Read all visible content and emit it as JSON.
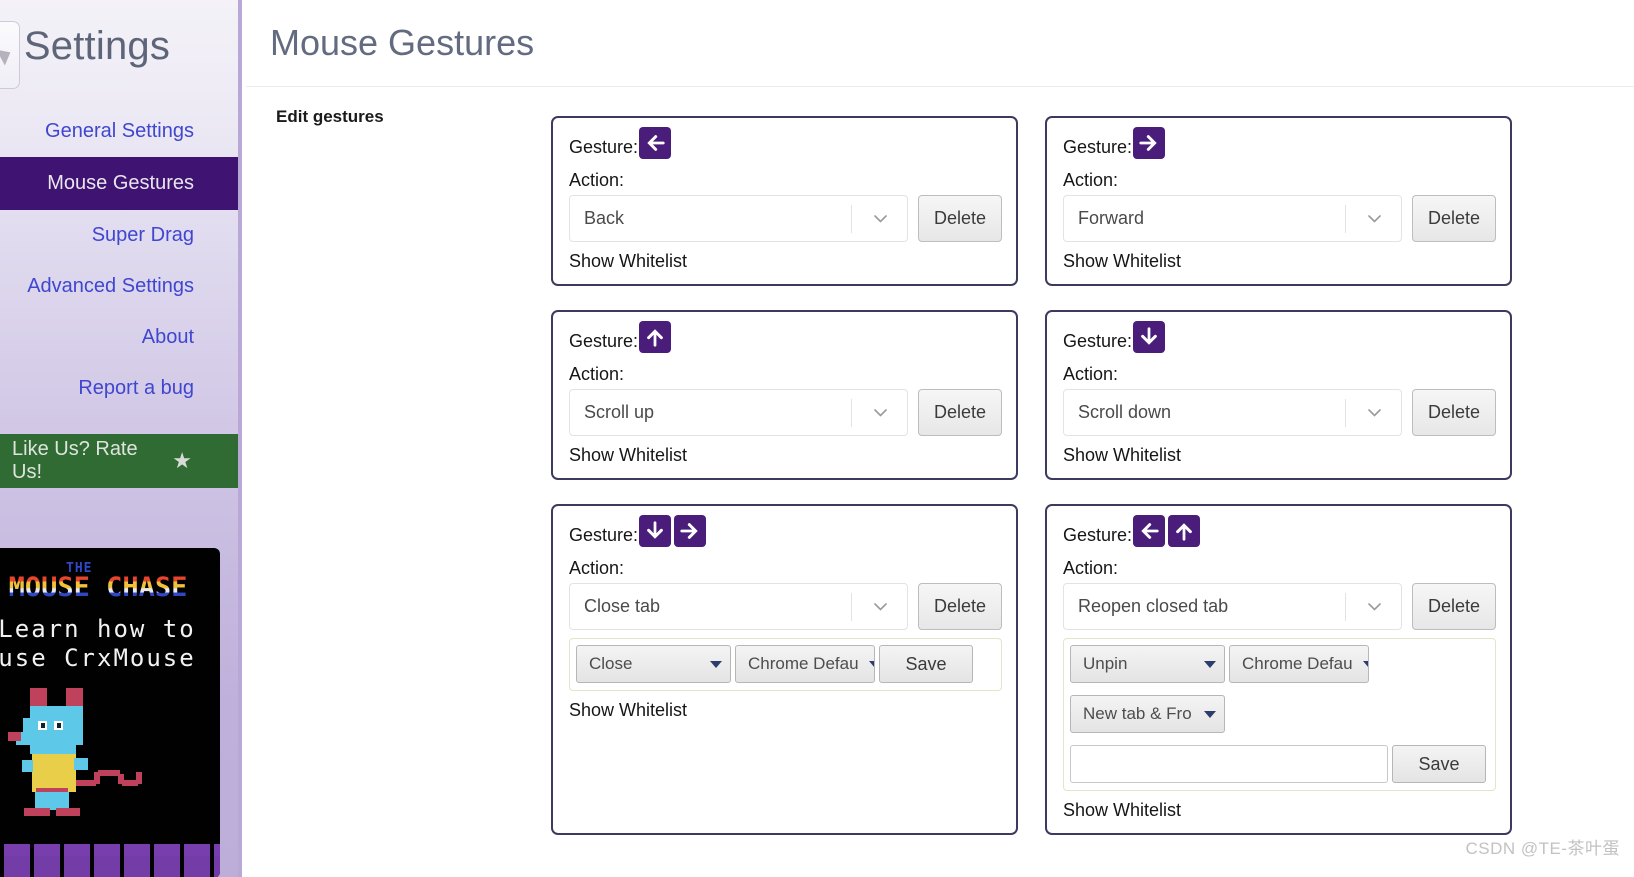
{
  "sidebar": {
    "title": "Settings",
    "collapse_icon": "collapse-arrow-icon",
    "items": [
      {
        "label": "General Settings",
        "active": false
      },
      {
        "label": "Mouse Gestures",
        "active": true
      },
      {
        "label": "Super Drag",
        "active": false
      },
      {
        "label": "Advanced Settings",
        "active": false
      },
      {
        "label": "About",
        "active": false
      },
      {
        "label": "Report a bug",
        "active": false
      }
    ],
    "rate": {
      "label": "Like Us? Rate Us!",
      "icon": "star-icon",
      "bg": "#2f6b33"
    },
    "ad": {
      "pre_title": "THE",
      "title": "MOUSE CHASE",
      "line1": "Learn how to",
      "line2": "use CrxMouse",
      "art": "pixel-mouse-character"
    }
  },
  "header": {
    "title": "Mouse Gestures"
  },
  "main": {
    "section_label": "Edit gestures",
    "labels": {
      "gesture": "Gesture:",
      "action": "Action:",
      "delete": "Delete",
      "save": "Save",
      "show_whitelist": "Show Whitelist"
    },
    "cards": [
      {
        "id": "back",
        "gesture_icons": [
          "arrow-left"
        ],
        "action": "Back",
        "delete_label": "Delete",
        "show_whitelist": "Show Whitelist",
        "subpanel": null
      },
      {
        "id": "forward",
        "gesture_icons": [
          "arrow-right"
        ],
        "action": "Forward",
        "delete_label": "Delete",
        "show_whitelist": "Show Whitelist",
        "subpanel": null
      },
      {
        "id": "scroll-up",
        "gesture_icons": [
          "arrow-up"
        ],
        "action": "Scroll up",
        "delete_label": "Delete",
        "show_whitelist": "Show Whitelist",
        "subpanel": null
      },
      {
        "id": "scroll-down",
        "gesture_icons": [
          "arrow-down"
        ],
        "action": "Scroll down",
        "delete_label": "Delete",
        "show_whitelist": "Show Whitelist",
        "subpanel": null
      },
      {
        "id": "close-tab",
        "gesture_icons": [
          "arrow-down",
          "arrow-right"
        ],
        "action": "Close tab",
        "delete_label": "Delete",
        "show_whitelist": "Show Whitelist",
        "subpanel": {
          "select1": "Close",
          "select2": "Chrome Defau",
          "select3": null,
          "input_value": "",
          "save_label": "Save"
        }
      },
      {
        "id": "reopen-closed-tab",
        "gesture_icons": [
          "arrow-left",
          "arrow-up"
        ],
        "action": "Reopen closed tab",
        "delete_label": "Delete",
        "show_whitelist": "Show Whitelist",
        "subpanel": {
          "select1": "Unpin",
          "select2": "Chrome Defau",
          "select3": "New tab & Fro",
          "input_value": "",
          "save_label": "Save"
        }
      }
    ]
  },
  "watermark": "CSDN @TE-茶叶蛋",
  "colors": {
    "accent_purple": "#4b1d7a",
    "sidebar_active": "#3f1371",
    "link_blue": "#3f46d0",
    "rate_green": "#2f6b33",
    "card_border": "#3d3a60",
    "title_gray": "#636b80"
  }
}
